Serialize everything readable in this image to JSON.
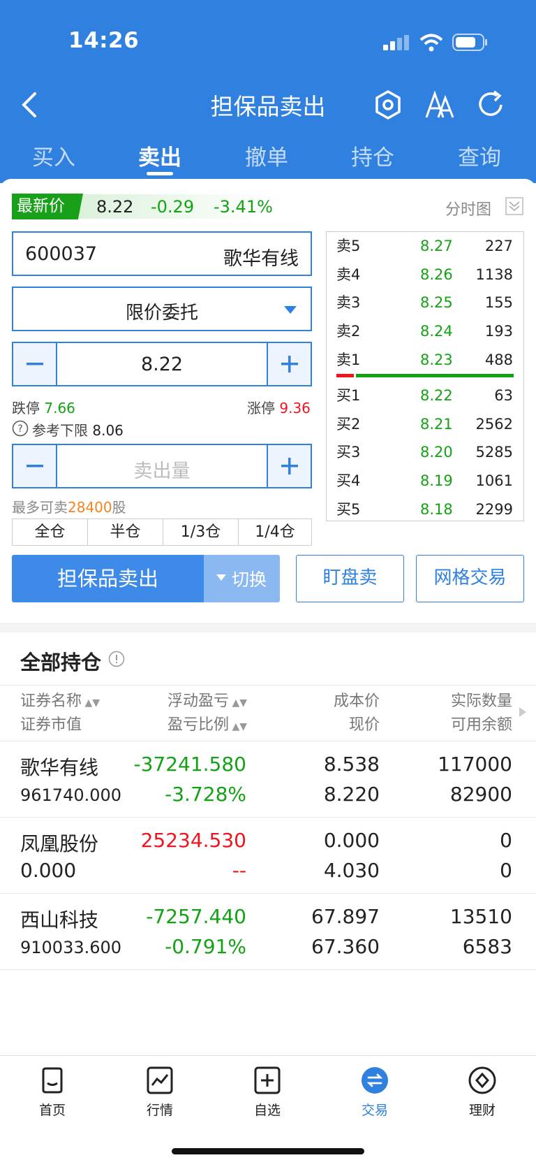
{
  "status": {
    "time": "14:26"
  },
  "header": {
    "title": "担保品卖出",
    "tabs": [
      "买入",
      "卖出",
      "撤单",
      "持仓",
      "查询"
    ]
  },
  "quote": {
    "tag": "最新价",
    "price": "8.22",
    "change": "-0.29",
    "change_pct": "-3.41%",
    "chart_label": "分时图"
  },
  "form": {
    "code": "600037",
    "name": "歌华有线",
    "order_type": "限价委托",
    "price": "8.22",
    "limit_down_label": "跌停",
    "limit_down": "7.66",
    "limit_up_label": "涨停",
    "limit_up": "9.36",
    "ref_label": "参考下限",
    "ref_value": "8.06",
    "qty_placeholder": "卖出量",
    "max_prefix": "最多可卖",
    "max_value": "28400",
    "max_suffix": "股",
    "quick": [
      "全仓",
      "半仓",
      "1/3仓",
      "1/4仓"
    ],
    "sell_btn": "担保品卖出",
    "switch_btn": "切换",
    "watch_btn": "盯盘卖",
    "grid_btn": "网格交易"
  },
  "orderbook": {
    "sell": [
      {
        "label": "卖5",
        "price": "8.27",
        "vol": "227"
      },
      {
        "label": "卖4",
        "price": "8.26",
        "vol": "1138"
      },
      {
        "label": "卖3",
        "price": "8.25",
        "vol": "155"
      },
      {
        "label": "卖2",
        "price": "8.24",
        "vol": "193"
      },
      {
        "label": "卖1",
        "price": "8.23",
        "vol": "488"
      }
    ],
    "buy": [
      {
        "label": "买1",
        "price": "8.22",
        "vol": "63"
      },
      {
        "label": "买2",
        "price": "8.21",
        "vol": "2562"
      },
      {
        "label": "买3",
        "price": "8.20",
        "vol": "5285"
      },
      {
        "label": "买4",
        "price": "8.19",
        "vol": "1061"
      },
      {
        "label": "买5",
        "price": "8.18",
        "vol": "2299"
      }
    ]
  },
  "positions": {
    "title": "全部持仓",
    "headers": {
      "c1a": "证券名称",
      "c1b": "证券市值",
      "c2a": "浮动盈亏",
      "c2b": "盈亏比例",
      "c3a": "成本价",
      "c3b": "现价",
      "c4a": "实际数量",
      "c4b": "可用余额"
    },
    "rows": [
      {
        "name": "歌华有线",
        "market_value": "961740.000",
        "pnl": "-37241.580",
        "pnl_pct": "-3.728%",
        "cost": "8.538",
        "price": "8.220",
        "qty": "117000",
        "avail": "82900"
      },
      {
        "name": "凤凰股份",
        "market_value": "0.000",
        "pnl": "25234.530",
        "pnl_pct": "--",
        "cost": "0.000",
        "price": "4.030",
        "qty": "0",
        "avail": "0"
      },
      {
        "name": "西山科技",
        "market_value": "910033.600",
        "pnl": "-7257.440",
        "pnl_pct": "-0.791%",
        "cost": "67.897",
        "price": "67.360",
        "qty": "13510",
        "avail": "6583"
      }
    ]
  },
  "nav": [
    {
      "label": "首页",
      "icon": "home-icon"
    },
    {
      "label": "行情",
      "icon": "chart-icon"
    },
    {
      "label": "自选",
      "icon": "add-watchlist-icon"
    },
    {
      "label": "交易",
      "icon": "trade-icon"
    },
    {
      "label": "理财",
      "icon": "finance-icon"
    }
  ],
  "colors": {
    "brand": "#2f80df",
    "up": "#f0141e",
    "down": "#13a213"
  }
}
